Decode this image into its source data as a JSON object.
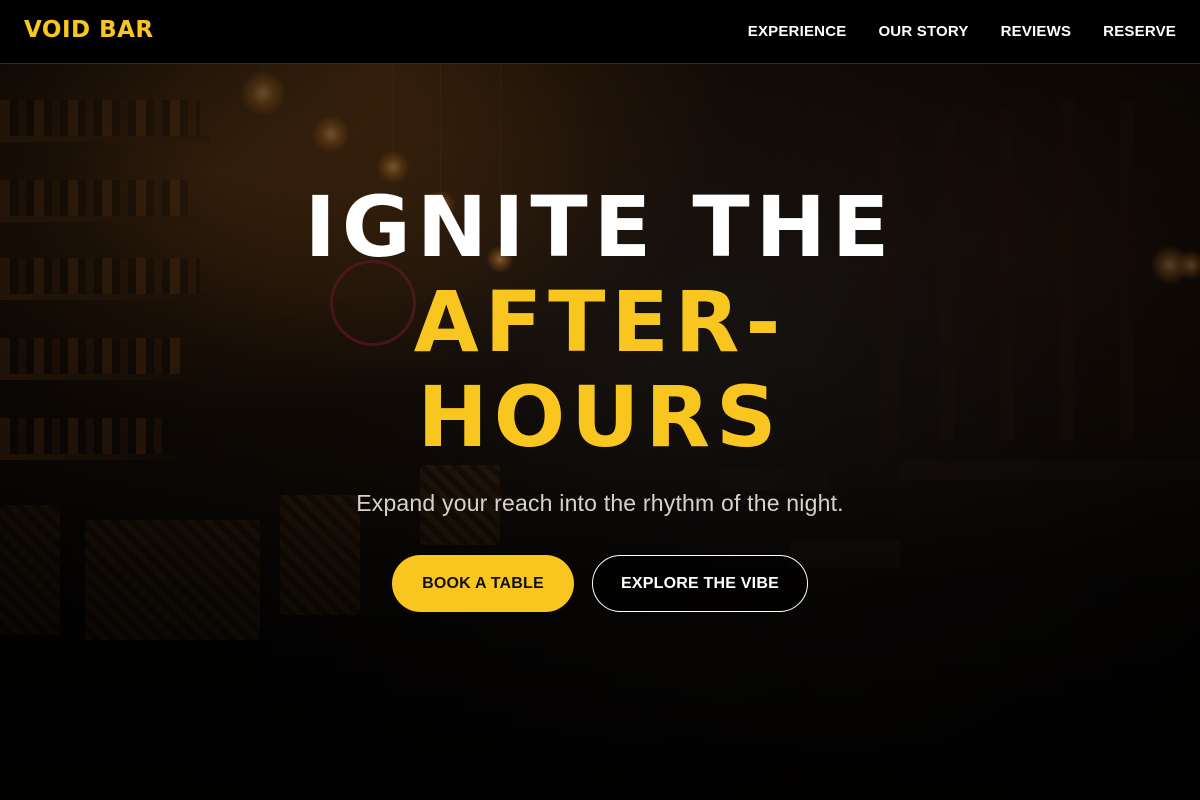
{
  "brand": {
    "name": "VOID BAR",
    "accent_color": "#f8c61f"
  },
  "nav": {
    "items": [
      {
        "label": "EXPERIENCE"
      },
      {
        "label": "OUR STORY"
      },
      {
        "label": "REVIEWS"
      },
      {
        "label": "RESERVE"
      }
    ]
  },
  "hero": {
    "title_line_1": "IGNITE THE",
    "title_line_2": "AFTER-",
    "title_line_3": "HOURS",
    "subtitle": "Expand your reach into the rhythm of the night.",
    "primary_cta": "BOOK A TABLE",
    "secondary_cta": "EXPLORE THE VIBE"
  },
  "colors": {
    "background": "#050505",
    "accent": "#f8c61f",
    "text_primary": "#ffffff",
    "text_secondary": "#d7d2c9"
  }
}
